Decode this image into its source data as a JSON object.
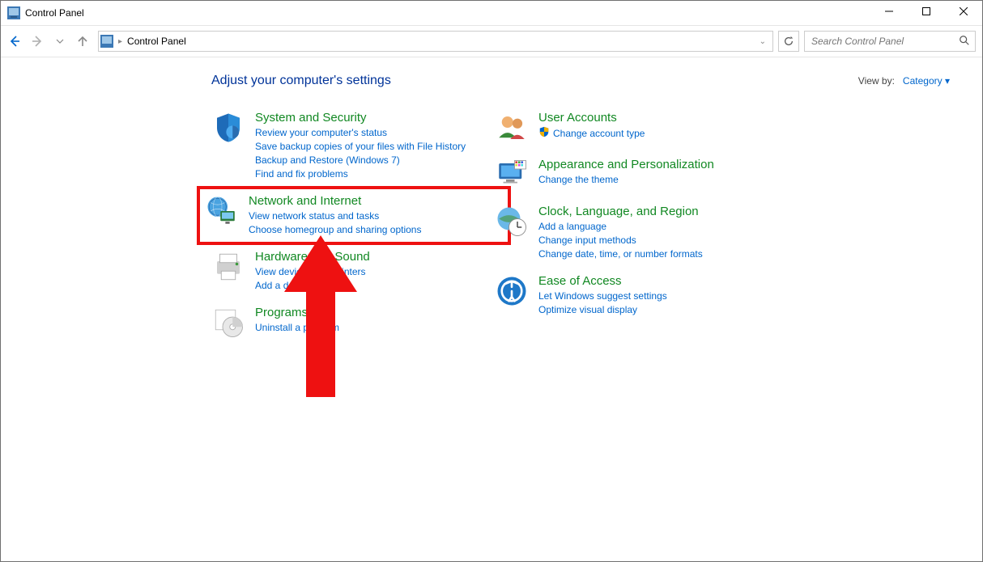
{
  "window": {
    "title": "Control Panel"
  },
  "addressbar": {
    "crumb1": "Control Panel"
  },
  "search": {
    "placeholder": "Search Control Panel"
  },
  "header": {
    "title": "Adjust your computer's settings"
  },
  "viewby": {
    "label": "View by:",
    "value": "Category"
  },
  "cats": {
    "system": {
      "title": "System and Security",
      "links": [
        "Review your computer's status",
        "Save backup copies of your files with File History",
        "Backup and Restore (Windows 7)",
        "Find and fix problems"
      ]
    },
    "network": {
      "title": "Network and Internet",
      "links": [
        "View network status and tasks",
        "Choose homegroup and sharing options"
      ]
    },
    "hardware": {
      "title": "Hardware and Sound",
      "links": [
        "View devices and printers",
        "Add a device"
      ]
    },
    "programs": {
      "title": "Programs",
      "links": [
        "Uninstall a program"
      ]
    },
    "users": {
      "title": "User Accounts",
      "links": [
        "Change account type"
      ]
    },
    "appearance": {
      "title": "Appearance and Personalization",
      "links": [
        "Change the theme"
      ]
    },
    "clock": {
      "title": "Clock, Language, and Region",
      "links": [
        "Add a language",
        "Change input methods",
        "Change date, time, or number formats"
      ]
    },
    "ease": {
      "title": "Ease of Access",
      "links": [
        "Let Windows suggest settings",
        "Optimize visual display"
      ]
    }
  }
}
